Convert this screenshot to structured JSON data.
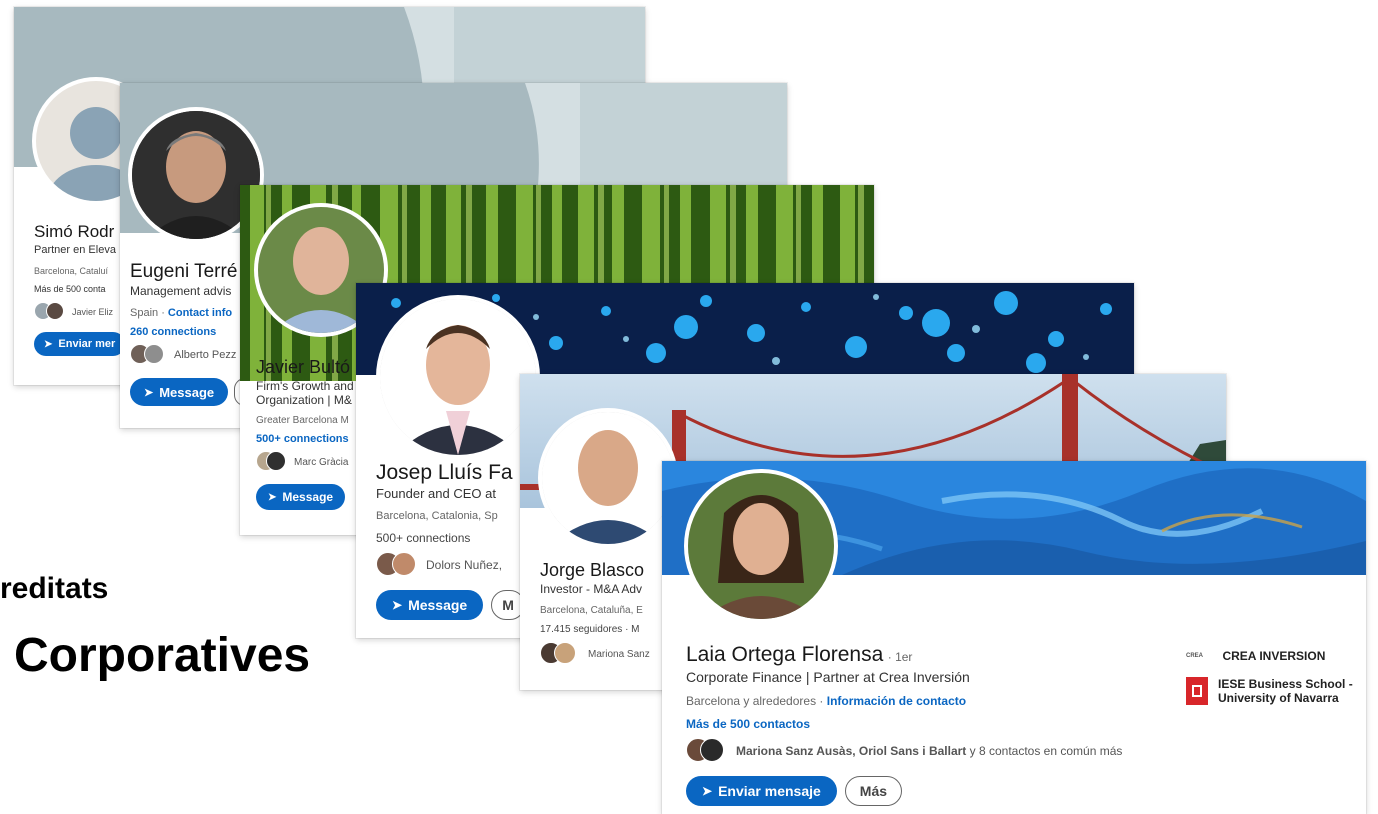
{
  "background_text": {
    "line1": "reditats",
    "line2": "Corporatives"
  },
  "colors": {
    "accent": "#0a66c2"
  },
  "cards": {
    "simo": {
      "name": "Simó Rodr",
      "headline": "Partner en Eleva",
      "location": "Barcelona, Cataluí",
      "connections": "Más de 500 conta",
      "mutual": "Javier Eliz",
      "button": "Enviar mer"
    },
    "eugeni": {
      "name": "Eugeni Terré",
      "headline": "Management advis",
      "location": "Spain · ",
      "contact": "Contact info",
      "connections": "260 connections",
      "mutual": "Alberto Pezz",
      "button": "Message"
    },
    "javier": {
      "name": "Javier Bultó",
      "headline1": "Firm's Growth and",
      "headline2": "Organization | M&",
      "location": "Greater Barcelona M",
      "connections": "500+ connections",
      "mutual": "Marc Gràcia",
      "button": "Message"
    },
    "josep": {
      "name": "Josep Lluís Fa",
      "headline": "Founder and CEO at",
      "location": "Barcelona, Catalonia, Sp",
      "connections": "500+ connections",
      "mutual": "Dolors Nuñez,",
      "button": "Message",
      "secondary": "M"
    },
    "jorge": {
      "name": "Jorge Blasco",
      "headline": "Investor - M&A Adv",
      "location": "Barcelona, Cataluña, E",
      "followers": "17.415 seguidores · M",
      "mutual": "Mariona Sanz"
    },
    "laia": {
      "name": "Laia Ortega Florensa",
      "degree": "· 1er",
      "headline": "Corporate Finance | Partner at Crea Inversión",
      "location": "Barcelona y alrededores · ",
      "contact": "Información de contacto",
      "connections": "Más de 500 contactos",
      "mutual_names": "Mariona Sanz Ausàs, Oriol Sans i Ballart",
      "mutual_rest": " y 8 contactos en común más",
      "button": "Enviar mensaje",
      "secondary": "Más",
      "company": "CREA INVERSION",
      "company_logo_text": "CREA",
      "school1": "IESE Business School -",
      "school2": "University of Navarra"
    }
  }
}
